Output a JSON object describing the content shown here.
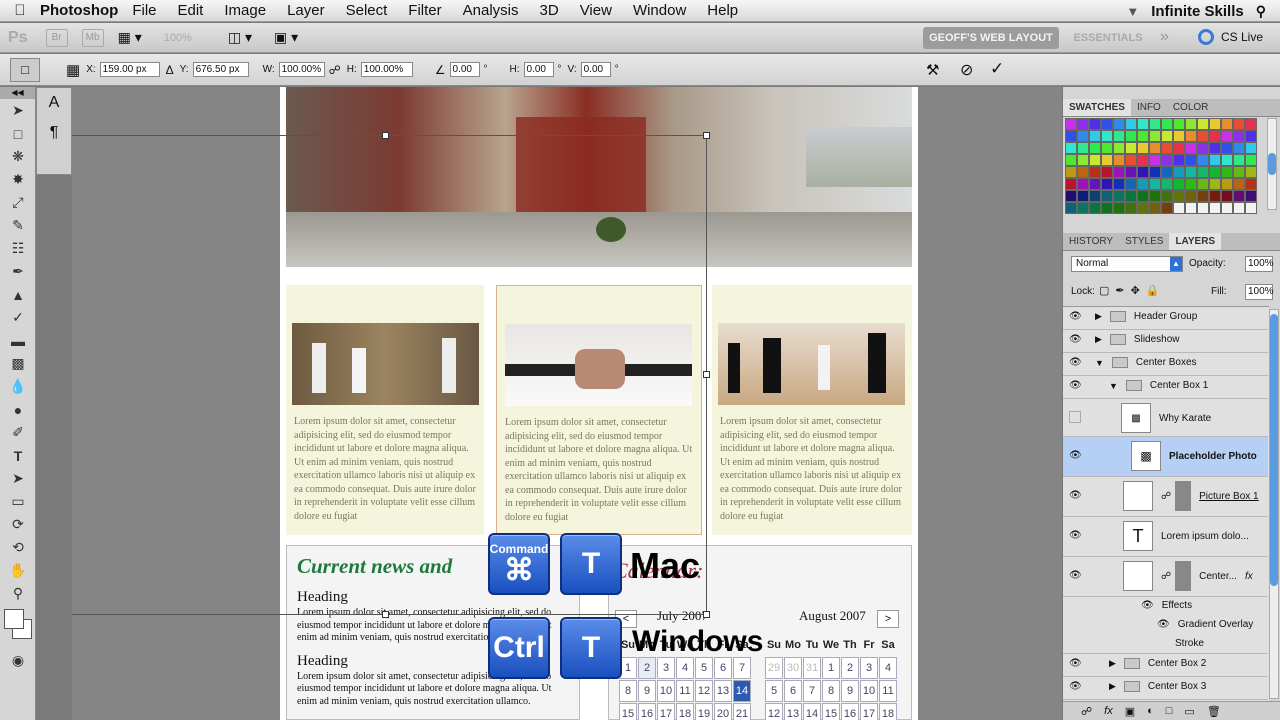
{
  "menubar": {
    "app": "Photoshop",
    "items": [
      "File",
      "Edit",
      "Image",
      "Layer",
      "Select",
      "Filter",
      "Analysis",
      "3D",
      "View",
      "Window",
      "Help"
    ],
    "right": "Infinite Skills"
  },
  "appbar": {
    "ps": "Ps",
    "zoom": "100%",
    "workspace_active": "GEOFF'S WEB LAYOUT",
    "workspace_other": "ESSENTIALS",
    "more": "»",
    "cslive": "CS Live"
  },
  "options": {
    "x": "159.00 px",
    "y": "676.50 px",
    "w": "100.00%",
    "h": "100.00%",
    "angle": "0.00",
    "hskew": "0.00",
    "vskew": "0.00",
    "x_lbl": "X:",
    "y_lbl": "Y:",
    "w_lbl": "W:",
    "h_lbl": "H:",
    "h2_lbl": "H:",
    "v_lbl": "V:",
    "delta": "Δ",
    "deg1": "°",
    "deg2": "°",
    "deg3": "°"
  },
  "document": {
    "lorem": "Lorem ipsum dolor sit amet, consectetur adipisicing elit, sed do eiusmod tempor incididunt ut labore et dolore magna aliqua. Ut enim ad minim veniam, quis nostrud exercitation ullamco laboris nisi ut aliquip ex ea commodo consequat. Duis aute irure dolor in reprehenderit in voluptate velit esse cillum dolore eu fugiat",
    "news_title": "Current news and",
    "news_heading1": "Heading",
    "news_body1": "Lorem ipsum dolor sit amet, consectetur adipisicing elit, sed do eiusmod tempor incididunt ut labore et dolore magna aliqua. Ut enim ad minim veniam, quis nostrud exercitation",
    "news_heading2": "Heading",
    "news_body2": "Lorem ipsum dolor sit amet, consectetur adipisicing elit, sed do eiusmod tempor incididunt ut labore et dolore magna aliqua. Ut enim ad minim veniam, quis nostrud exercitation ullamco.",
    "cal_title": "Calendar:",
    "cal_prev": "<",
    "cal_next": ">",
    "month1": "July 2007",
    "month2": "August 2007",
    "days": [
      "Su",
      "Mo",
      "Tu",
      "We",
      "Th",
      "Fr",
      "Sa"
    ],
    "july_rows": [
      [
        "1",
        "2",
        "3",
        "4",
        "5",
        "6",
        "7"
      ],
      [
        "8",
        "9",
        "10",
        "11",
        "12",
        "13",
        "14"
      ],
      [
        "15",
        "16",
        "17",
        "18",
        "19",
        "20",
        "21"
      ]
    ],
    "aug_rows": [
      [
        "29",
        "30",
        "31",
        "1",
        "2",
        "3",
        "4"
      ],
      [
        "5",
        "6",
        "7",
        "8",
        "9",
        "10",
        "11"
      ],
      [
        "12",
        "13",
        "14",
        "15",
        "16",
        "17",
        "18"
      ]
    ]
  },
  "overlay": {
    "command_label": "Command",
    "command_sym": "⌘",
    "t": "T",
    "mac": "Mac",
    "ctrl": "Ctrl",
    "windows": "Windows"
  },
  "panels": {
    "tabs1": [
      "SWATCHES",
      "INFO",
      "COLOR"
    ],
    "tabs2": [
      "HISTORY",
      "STYLES",
      "LAYERS"
    ],
    "blend": "Normal",
    "opacity_lbl": "Opacity:",
    "opacity": "100%",
    "lock_lbl": "Lock:",
    "fill_lbl": "Fill:",
    "fill": "100%",
    "layers": [
      "Header Group",
      "Slideshow",
      "Center Boxes",
      "Center Box 1",
      "Why Karate",
      "Placeholder Photo",
      "Picture Box 1",
      "Lorem ipsum dolo...",
      "Center...",
      "Effects",
      "Gradient Overlay",
      "Stroke",
      "Center Box 2",
      "Center Box 3"
    ],
    "fx": "fx"
  }
}
